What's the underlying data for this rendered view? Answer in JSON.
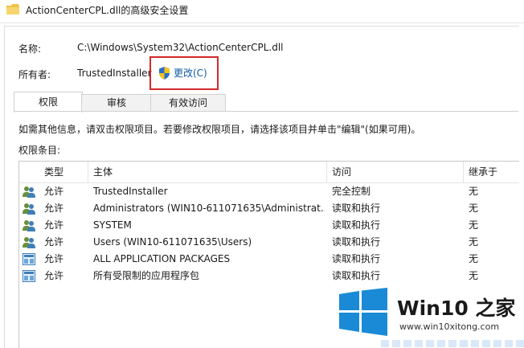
{
  "window": {
    "title": "ActionCenterCPL.dll的高级安全设置"
  },
  "fields": {
    "name_label": "名称:",
    "name_value": "C:\\Windows\\System32\\ActionCenterCPL.dll",
    "owner_label": "所有者:",
    "owner_value": "TrustedInstaller",
    "change_label": "更改(C)"
  },
  "tabs": [
    {
      "label": "权限",
      "active": true
    },
    {
      "label": "审核",
      "active": false
    },
    {
      "label": "有效访问",
      "active": false
    }
  ],
  "info_text": "如需其他信息，请双击权限项目。若要修改权限项目，请选择该项目并单击\"编辑\"(如果可用)。",
  "entries_label": "权限条目:",
  "table": {
    "columns": [
      "类型",
      "主体",
      "访问",
      "继承于"
    ],
    "rows": [
      {
        "icon": "users-icon",
        "type": "允许",
        "principal": "TrustedInstaller",
        "access": "完全控制",
        "inherit": "无"
      },
      {
        "icon": "users-icon",
        "type": "允许",
        "principal": "Administrators (WIN10-611071635\\Administrat...",
        "access": "读取和执行",
        "inherit": "无"
      },
      {
        "icon": "users-icon",
        "type": "允许",
        "principal": "SYSTEM",
        "access": "读取和执行",
        "inherit": "无"
      },
      {
        "icon": "users-icon",
        "type": "允许",
        "principal": "Users (WIN10-611071635\\Users)",
        "access": "读取和执行",
        "inherit": "无"
      },
      {
        "icon": "app-package-icon",
        "type": "允许",
        "principal": "ALL APPLICATION PACKAGES",
        "access": "读取和执行",
        "inherit": "无"
      },
      {
        "icon": "app-package-icon",
        "type": "允许",
        "principal": "所有受限制的应用程序包",
        "access": "读取和执行",
        "inherit": "无"
      }
    ]
  },
  "watermark": {
    "brand": "Win10 之家",
    "url": "www.win10xitong.com"
  },
  "colors": {
    "link": "#0f5aa8",
    "highlight_box": "#d42a2a",
    "win_logo": "#1a8ad6"
  }
}
